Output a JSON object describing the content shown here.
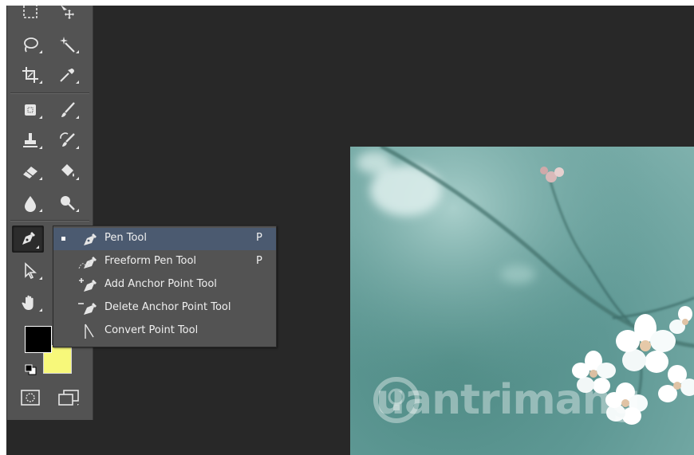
{
  "toolbar": {
    "tools": [
      {
        "name": "marquee-tool-icon"
      },
      {
        "name": "move-tool-icon"
      },
      {
        "name": "lasso-tool-icon"
      },
      {
        "name": "magic-wand-tool-icon"
      },
      {
        "name": "crop-tool-icon"
      },
      {
        "name": "eyedropper-tool-icon"
      },
      {
        "name": "healing-brush-tool-icon"
      },
      {
        "name": "brush-tool-icon"
      },
      {
        "name": "clone-stamp-tool-icon"
      },
      {
        "name": "history-brush-tool-icon"
      },
      {
        "name": "eraser-tool-icon"
      },
      {
        "name": "paint-bucket-tool-icon"
      },
      {
        "name": "blur-tool-icon"
      },
      {
        "name": "dodge-tool-icon"
      },
      {
        "name": "pen-tool-icon"
      },
      {
        "name": "path-selection-tool-icon"
      },
      {
        "name": "hand-tool-icon"
      }
    ],
    "foreground_color": "#000000",
    "background_color": "#f7f87a"
  },
  "flyout": {
    "items": [
      {
        "label": "Pen Tool",
        "shortcut": "P",
        "selected": true,
        "icon": "pen-icon"
      },
      {
        "label": "Freeform Pen Tool",
        "shortcut": "P",
        "selected": false,
        "icon": "freeform-pen-icon"
      },
      {
        "label": "Add Anchor Point Tool",
        "shortcut": "",
        "selected": false,
        "icon": "add-anchor-point-icon"
      },
      {
        "label": "Delete Anchor Point Tool",
        "shortcut": "",
        "selected": false,
        "icon": "delete-anchor-point-icon"
      },
      {
        "label": "Convert Point Tool",
        "shortcut": "",
        "selected": false,
        "icon": "convert-point-icon"
      }
    ],
    "highlight_color": "#4b5a70"
  },
  "canvas": {
    "watermark": "uantrimang"
  }
}
